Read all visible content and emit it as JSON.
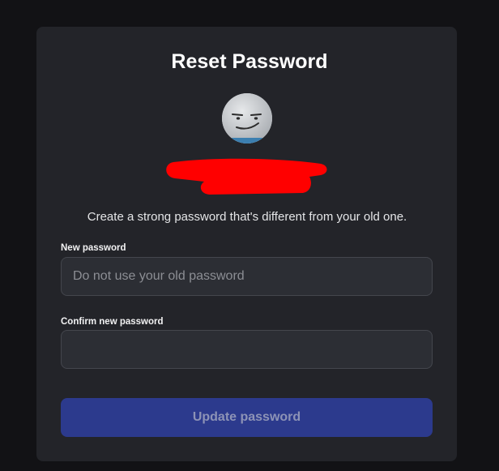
{
  "header": {
    "title": "Reset Password"
  },
  "account": {
    "avatar_icon": "avatar-face-icon",
    "username_redacted": true
  },
  "form": {
    "description": "Create a strong password that's different from your old one.",
    "new_password": {
      "label": "New password",
      "placeholder": "Do not use your old password",
      "value": ""
    },
    "confirm_password": {
      "label": "Confirm new password",
      "placeholder": "",
      "value": ""
    },
    "submit_label": "Update password"
  },
  "colors": {
    "background": "#121215",
    "card": "#232429",
    "input": "#2c2e34",
    "button_disabled": "#2c3a8d",
    "redaction": "#ff0000"
  }
}
